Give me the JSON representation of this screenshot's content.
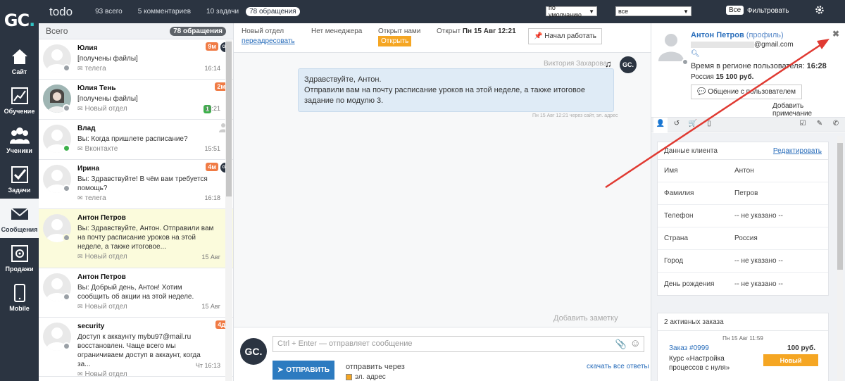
{
  "logo": {
    "text": "GC",
    "dot": "."
  },
  "nav": [
    {
      "label": "Сайт",
      "icon": "house-icon"
    },
    {
      "label": "Обучение",
      "icon": "chart-icon"
    },
    {
      "label": "Ученики",
      "icon": "users-icon"
    },
    {
      "label": "Задачи",
      "icon": "checkbox-icon"
    },
    {
      "label": "Сообщения",
      "icon": "envelope-icon",
      "active": true
    },
    {
      "label": "Продажи",
      "icon": "safe-icon"
    },
    {
      "label": "Mobile",
      "icon": "phone-icon"
    }
  ],
  "topbar": {
    "title": "todo",
    "stats": [
      "93 всего",
      "5 комментариев",
      "10 задачи",
      "78 обращения"
    ],
    "sort_select": "по умолчанию",
    "filter_select": "все",
    "all_button": "Все",
    "filter_label": "Фильтровать"
  },
  "convlist": {
    "header": "Всего",
    "count": "78 обращения",
    "items": [
      {
        "name": "Юлия",
        "text": "[получены файлы]",
        "channel": "телега",
        "time": "16:14",
        "tag": "9м",
        "gc": true
      },
      {
        "name": "Юлия Тень",
        "text": "[получены файлы]",
        "channel": "Новый отдел",
        "time": "16:21",
        "tag": "2м",
        "badge": "1"
      },
      {
        "name": "Влад",
        "text": "Вы: Когда пришлете расписание?",
        "channel": "Вконтакте",
        "time": "15:51",
        "person": true,
        "online": true
      },
      {
        "name": "Ирина",
        "text": "Вы: Здравствуйте! В чём вам требуется помощь?",
        "channel": "телега",
        "time": "16:18",
        "tag": "4м",
        "gc": true
      },
      {
        "name": "Антон Петров",
        "text": "Вы: Здравствуйте, Антон. Отправили вам на почту расписание уроков на этой неделе, а также итоговое...",
        "channel": "Новый отдел",
        "time": "15 Авг",
        "active": true
      },
      {
        "name": "Антон Петров",
        "text": "Вы: Добрый день, Антон! Хотим сообщить об акции на этой неделе.",
        "channel": "Новый отдел",
        "time": "15 Авг"
      },
      {
        "name": "security",
        "text": "Доступ к аккаунту mybu97@mail.ru восстановлен. Чаще всего мы ограничиваем доступ в аккаунт, когда за...",
        "channel": "Новый отдел",
        "time": "Чт 16:13",
        "tag": "4д"
      }
    ]
  },
  "center": {
    "dept_label": "Новый отдел",
    "dept_link": "переадресовать",
    "manager": "Нет менеджера",
    "opened_by": "Открыт нами",
    "open_btn": "Открыть",
    "opened_label": "Открыт",
    "opened_date": "Пн 15 Авг 12:21",
    "start_btn": "Начал работать",
    "sender": "Виктория Захарова",
    "gc_avatar": "GC.",
    "message": "Здравствуйте, Антон.\nОтправили вам на почту расписание уроков на этой неделе, а также итоговое задание по модулю 3.",
    "msg_time": "Пн 15 Авг 12:21 через сайт, эл. адрес",
    "add_note": "Добавить заметку",
    "input_placeholder": "Ctrl + Enter — отправляет сообщение",
    "send_btn": "ОТПРАВИТЬ",
    "send_via": "отправить через",
    "email_option": "эл. адрес",
    "download_link": "скачать все ответы"
  },
  "right": {
    "name": "Антон Петров",
    "profile": "(профиль)",
    "email_suffix": "@gmail.com",
    "region_time_label": "Время в регионе пользователя:",
    "region_time": "16:28",
    "country": "Россия",
    "revenue": "15 100 руб.",
    "chat_btn": "Общение с пользователем",
    "add_note": "Добавить примечание",
    "client_header": "Данные клиента",
    "edit": "Редактировать",
    "fields": [
      {
        "k": "Имя",
        "v": "Антон"
      },
      {
        "k": "Фамилия",
        "v": "Петров"
      },
      {
        "k": "Телефон",
        "v": "-- не указано --"
      },
      {
        "k": "Страна",
        "v": "Россия"
      },
      {
        "k": "Город",
        "v": "-- не указано --"
      },
      {
        "k": "День рождения",
        "v": "-- не указано --"
      }
    ],
    "orders_header": "2 активных заказа",
    "order": {
      "date": "Пн 15 Авг 11:59",
      "link": "Заказ #0999",
      "price": "100 руб.",
      "desc": "Курс «Настройка процессов с нуля»",
      "status": "Новый"
    }
  },
  "colors": {
    "nav": "#2b3441",
    "accent": "#f5a623",
    "link": "#2a6ebb",
    "arrow": "#e03a32"
  }
}
